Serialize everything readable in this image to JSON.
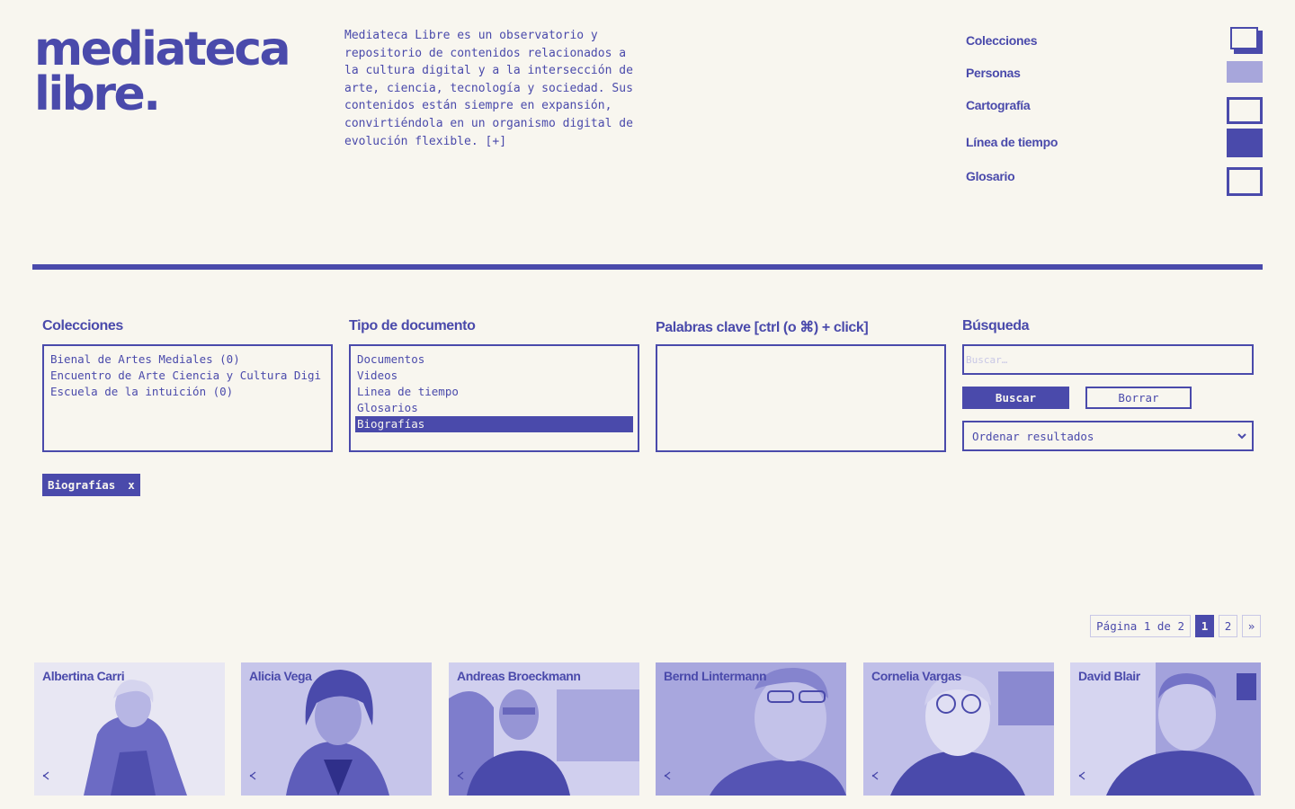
{
  "logo": {
    "line1": "mediateca",
    "line2": "libre."
  },
  "intro": {
    "text": "Mediateca Libre es un observatorio y repositorio de contenidos relacionados a la cultura digital y a la intersección de arte, ciencia, tecnología y sociedad. Sus contenidos están siempre en expansión, convirtiéndola en un organismo digital de evolución flexible.",
    "more": "[+]"
  },
  "nav": {
    "items": [
      {
        "label": "Colecciones"
      },
      {
        "label": "Personas"
      },
      {
        "label": "Cartografía"
      },
      {
        "label": "Línea de tiempo"
      },
      {
        "label": "Glosario"
      }
    ]
  },
  "accent": "#4a4aab",
  "background": "#f8f6ef",
  "filters": {
    "collections": {
      "title": "Colecciones",
      "options": [
        "Bienal de Artes Mediales  (0)",
        "Encuentro de Arte Ciencia y Cultura Digi",
        "Escuela de la intuición  (0)"
      ]
    },
    "doc_type": {
      "title": "Tipo de documento",
      "options": [
        "Documentos",
        "Videos",
        "Linea de tiempo",
        "Glosarios",
        "Biografías"
      ],
      "selected": "Biografías"
    },
    "keywords": {
      "title": "Palabras clave [ctrl (o ⌘) + click]"
    },
    "search": {
      "title": "Búsqueda",
      "placeholder": "Buscar…",
      "value": "",
      "submit_label": "Buscar",
      "clear_label": "Borrar",
      "sort_label": "Ordenar resultados"
    }
  },
  "active_tag": {
    "label": "Biografías",
    "remove": "x"
  },
  "pagination": {
    "info": "Página 1 de 2",
    "pages": [
      "1",
      "2"
    ],
    "current": "1",
    "next": "»"
  },
  "results": [
    {
      "name": "Albertina Carri",
      "icon": "share-icon"
    },
    {
      "name": "Alicia Vega",
      "icon": "share-icon"
    },
    {
      "name": "Andreas Broeckmann",
      "icon": "share-icon"
    },
    {
      "name": "Bernd Lintermann",
      "icon": "share-icon"
    },
    {
      "name": "Cornelia Vargas",
      "icon": "share-icon"
    },
    {
      "name": "David Blair",
      "icon": "share-icon"
    }
  ]
}
